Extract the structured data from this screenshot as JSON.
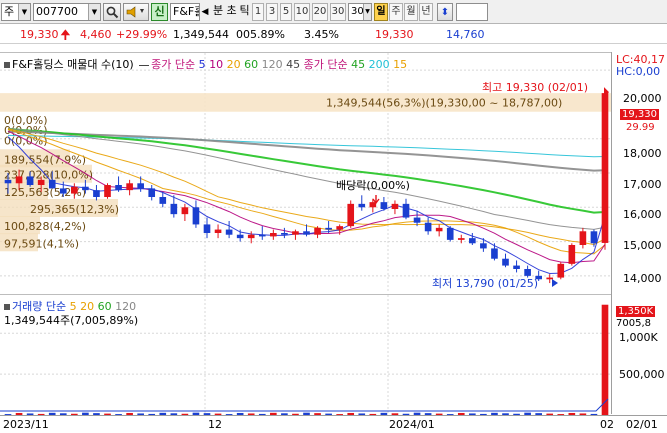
{
  "toolbar": {
    "market": "주",
    "code": "007700",
    "search_icon": "search-icon",
    "sound_icon": "speaker-icon",
    "new_badge": "신",
    "name": "F&F홀",
    "prev_icon": "triangle-left-icon",
    "minute_label": "분",
    "tick_label": "초",
    "tick2_label": "틱",
    "intervals": [
      "1",
      "3",
      "5",
      "10",
      "20",
      "30",
      "30"
    ],
    "day_label": "일",
    "week_label": "주",
    "month_label": "월",
    "year_label": "년",
    "updown_icon": "updown-arrow-icon"
  },
  "quote": {
    "price": "19,330",
    "arrow": "up-arrow-icon",
    "change": "4,460",
    "change_pct": "+29.99%",
    "volume": "1,349,544",
    "vol_ratio": "005.89%",
    "turnover": "3.45%",
    "high": "19,330",
    "low": "14,760"
  },
  "price_pane": {
    "title": "F&F홀딩스 매물대 수(10)",
    "ma_legend_1_label": "종가 단순",
    "ma_legend_1": [
      "5",
      "10",
      "20",
      "60",
      "120",
      "45"
    ],
    "ma_legend_2_label": "종가 단순",
    "ma_legend_2": [
      "45",
      "200",
      "15"
    ],
    "volume_profile": [
      "0(0,0%)",
      "0(0,0%)",
      "0(0,0%)",
      "189,554(7.9%)",
      "237,028(10,0%)",
      "125,563(5,2%)",
      "295,365(12,3%)",
      "100,828(4,2%)",
      "97,591(4,1%)"
    ],
    "highlight_band": "1,349,544(56,3%)(19,330,00 ~ 18,787,00)",
    "max_label": "최고 19,330 (02/01)",
    "min_label": "최저 13,790 (01/25)",
    "dividend_label": "배당락(0,00%)"
  },
  "vol_pane": {
    "legend_label": "거래량 단순",
    "legend_values": [
      "5",
      "20",
      "60",
      "120"
    ],
    "volume_text": "1,349,544주(7,005,89%)"
  },
  "right_axis": {
    "lc": "LC:40,17",
    "hc": "HC:0,00",
    "price_ticks": [
      "20,000",
      "18,000",
      "17,000",
      "16,000",
      "15,000",
      "14,000"
    ],
    "price_tag": "19,330",
    "price_tag2": "29.99",
    "vol_tag": "1,350K",
    "vol_tag2": "7005,8",
    "vol_ticks": [
      "1,000K",
      "500,000"
    ]
  },
  "date_axis": {
    "labels": [
      "2023/11",
      "12",
      "2024/01",
      "02",
      "02/01"
    ]
  },
  "colors": {
    "up": "#e4141a",
    "down": "#1a3fd0",
    "ma5": "#1f2fd6",
    "ma10": "#b5007c",
    "ma20": "#e8a000",
    "ma60": "#22c322",
    "ma120": "#888888",
    "ma200": "#21c0d6"
  },
  "chart_data": {
    "type": "candlestick",
    "candles": [
      [
        16800,
        17000,
        16400,
        16700
      ],
      [
        16700,
        17100,
        16500,
        16900
      ],
      [
        16900,
        17050,
        16600,
        16650
      ],
      [
        16650,
        16900,
        16450,
        16800
      ],
      [
        16800,
        17050,
        16600,
        16550
      ],
      [
        16550,
        16750,
        16300,
        16400
      ],
      [
        16400,
        16700,
        16250,
        16600
      ],
      [
        16600,
        16800,
        16400,
        16500
      ],
      [
        16500,
        16650,
        16200,
        16300
      ],
      [
        16300,
        16700,
        16250,
        16650
      ],
      [
        16650,
        16900,
        16450,
        16500
      ],
      [
        16500,
        16800,
        16350,
        16700
      ],
      [
        16700,
        16900,
        16450,
        16550
      ],
      [
        16550,
        16650,
        16200,
        16300
      ],
      [
        16300,
        16450,
        16000,
        16100
      ],
      [
        16100,
        16350,
        15700,
        15800
      ],
      [
        15800,
        16100,
        15600,
        16000
      ],
      [
        16000,
        16200,
        15400,
        15500
      ],
      [
        15500,
        15700,
        15100,
        15250
      ],
      [
        15250,
        15500,
        15100,
        15350
      ],
      [
        15350,
        15600,
        15100,
        15200
      ],
      [
        15200,
        15350,
        15000,
        15100
      ],
      [
        15100,
        15300,
        14950,
        15200
      ],
      [
        15200,
        15450,
        15050,
        15150
      ],
      [
        15150,
        15350,
        15050,
        15250
      ],
      [
        15250,
        15400,
        15100,
        15200
      ],
      [
        15200,
        15350,
        15050,
        15300
      ],
      [
        15300,
        15500,
        15150,
        15200
      ],
      [
        15200,
        15450,
        15100,
        15400
      ],
      [
        15400,
        15600,
        15250,
        15350
      ],
      [
        15350,
        15500,
        15200,
        15450
      ],
      [
        15450,
        16200,
        15400,
        16100
      ],
      [
        16100,
        16350,
        15900,
        16000
      ],
      [
        16000,
        16250,
        15850,
        16150
      ],
      [
        16150,
        16300,
        15900,
        15950
      ],
      [
        15950,
        16200,
        15800,
        16100
      ],
      [
        16100,
        16250,
        15650,
        15700
      ],
      [
        15700,
        15900,
        15450,
        15550
      ],
      [
        15550,
        15700,
        15200,
        15300
      ],
      [
        15300,
        15500,
        15150,
        15400
      ],
      [
        15400,
        15450,
        15000,
        15050
      ],
      [
        15050,
        15200,
        14950,
        15100
      ],
      [
        15100,
        15250,
        14900,
        14950
      ],
      [
        14950,
        15100,
        14700,
        14800
      ],
      [
        14800,
        14950,
        14450,
        14500
      ],
      [
        14500,
        14650,
        14250,
        14300
      ],
      [
        14300,
        14450,
        14100,
        14200
      ],
      [
        14200,
        14300,
        13950,
        14000
      ],
      [
        14000,
        14150,
        13850,
        13900
      ],
      [
        13900,
        14050,
        13790,
        13950
      ],
      [
        13950,
        14400,
        13900,
        14350
      ],
      [
        14350,
        14950,
        14300,
        14900
      ],
      [
        14900,
        15400,
        14800,
        15300
      ],
      [
        15300,
        15350,
        14850,
        14950
      ],
      [
        14960,
        19330,
        14760,
        19330
      ]
    ],
    "price_range": [
      13500,
      20500
    ],
    "ma_periods": [
      "5",
      "10",
      "20",
      "60",
      "120",
      "200"
    ],
    "volume_unit": "K",
    "last_volume_k": 1350,
    "avg_volume_k": 19
  }
}
